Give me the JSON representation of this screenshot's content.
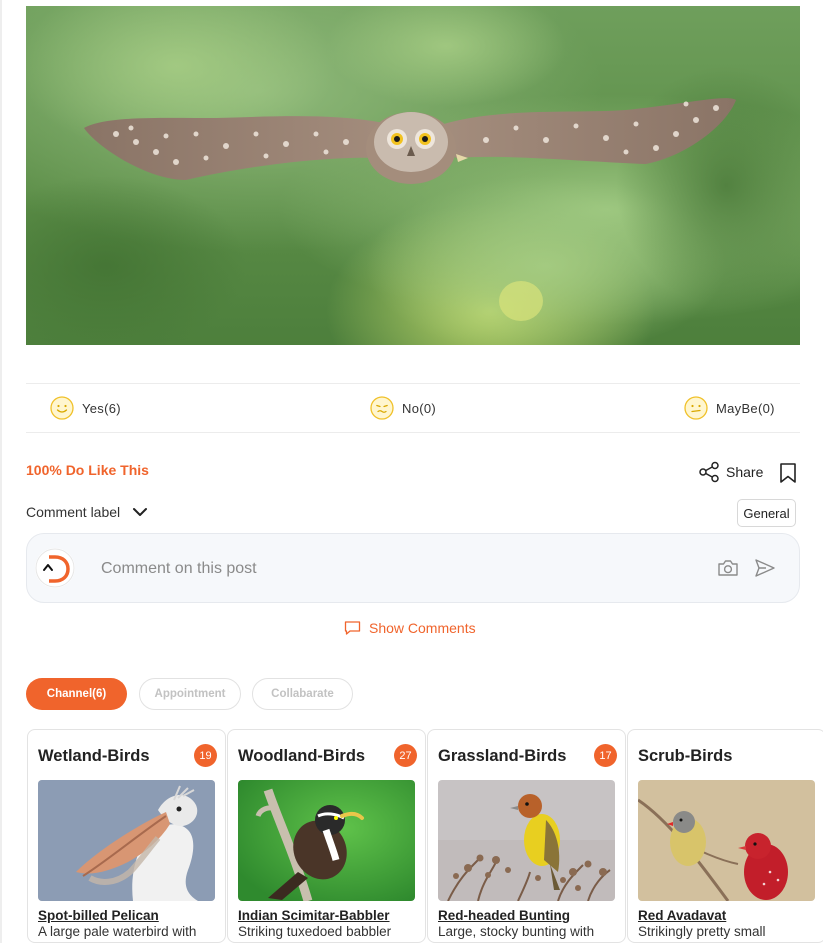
{
  "reactions": [
    {
      "face": "smile-face-icon",
      "label": "Yes(6)"
    },
    {
      "face": "wince-face-icon",
      "label": "No(0)"
    },
    {
      "face": "neutral-face-icon",
      "label": "MayBe(0)"
    }
  ],
  "post": {
    "like_percentage": "100% Do Like This",
    "share_label": "Share",
    "comment_label": "Comment label",
    "comment_category": "General",
    "comment_placeholder": "Comment on this post",
    "show_comments_label": "Show Comments"
  },
  "tabs": [
    {
      "label": "Channel(6)",
      "active": true
    },
    {
      "label": "Appointment",
      "active": false
    },
    {
      "label": "Collabarate",
      "active": false
    }
  ],
  "channels": [
    {
      "title": "Wetland-Birds",
      "count": "19",
      "bird": "Spot-billed Pelican",
      "description": "A large pale waterbird with"
    },
    {
      "title": "Woodland-Birds",
      "count": "27",
      "bird": "Indian Scimitar-Babbler",
      "description": "Striking tuxedoed babbler"
    },
    {
      "title": "Grassland-Birds",
      "count": "17",
      "bird": "Red-headed Bunting",
      "description": "Large, stocky bunting with"
    },
    {
      "title": "Scrub-Birds",
      "count": "",
      "bird": "Red Avadavat",
      "description": "Strikingly pretty small"
    }
  ],
  "colors": {
    "accent": "#f0642c",
    "reaction_yellow": "#f5c518",
    "border": "#e3e3e3"
  }
}
